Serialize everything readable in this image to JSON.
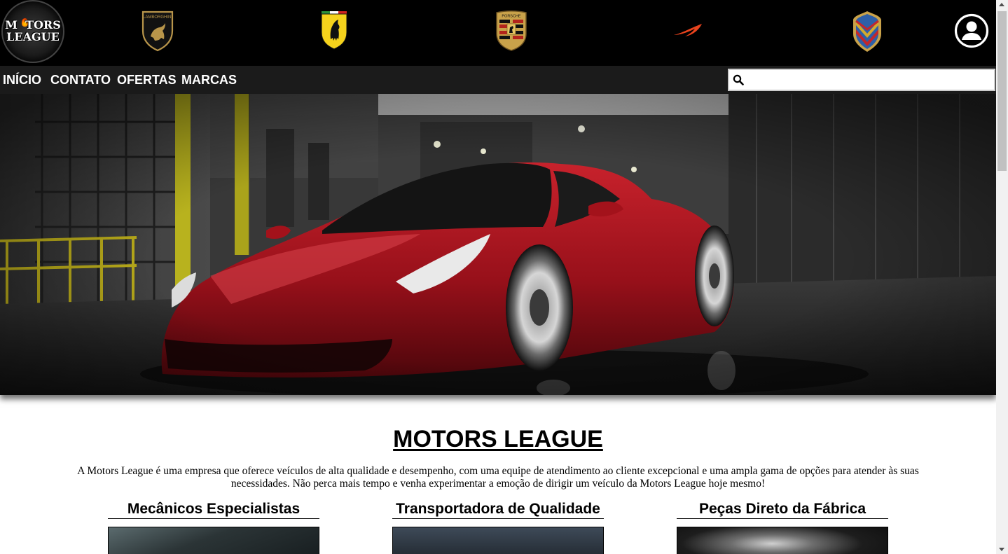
{
  "header": {
    "logo_text": "MOTORS\nLEAGUE",
    "brands": [
      "lamborghini-logo",
      "ferrari-logo",
      "porsche-logo",
      "mclaren-logo",
      "koenigsegg-logo"
    ],
    "brand_badge_texts": {
      "lamborghini": "LAMBORGHINI",
      "porsche": "PORSCHE"
    },
    "account_icon": "user-circle-icon"
  },
  "nav": {
    "items": [
      {
        "label": "INÍCIO"
      },
      {
        "label": "CONTATO"
      },
      {
        "label": "OFERTAS"
      },
      {
        "label": "MARCAS"
      }
    ],
    "search": {
      "value": "",
      "placeholder": "",
      "icon": "search-icon"
    }
  },
  "hero": {
    "image": "red Ferrari 458 parked in a dark industrial alley"
  },
  "main": {
    "title": "MOTORS LEAGUE",
    "intro": "A Motors League é uma empresa que oferece veículos de alta qualidade e desempenho, com uma equipe de atendimento ao cliente excepcional e uma ampla gama de opções para atender às suas necessidades. Não perca mais tempo e venha experimentar a emoção de dirigir um veículo da Motors League hoje mesmo!",
    "features": [
      {
        "title": "Mecânicos Especialistas"
      },
      {
        "title": "Transportadora de Qualidade"
      },
      {
        "title": "Peças Direto da Fábrica"
      }
    ]
  },
  "colors": {
    "topbar": "#000000",
    "navbar": "#1b1b1b",
    "nav_text": "#ffffff",
    "car_red": "#a3121b"
  }
}
